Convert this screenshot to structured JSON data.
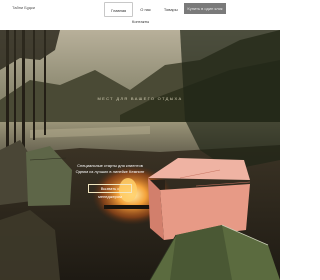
{
  "header": {
    "logo": "Тайни Будки",
    "nav": [
      {
        "label": "Главная",
        "active": true
      },
      {
        "label": "О нас",
        "active": false
      },
      {
        "label": "Товары",
        "active": false
      }
    ],
    "contacts": "Контакты",
    "cta_label": "Купить в один клик"
  },
  "hero": {
    "tagline": "МЕСТ ДЛЯ ВАШЕГО ОТДЫХА",
    "lines": [
      "Специальные старты для клиентов",
      "Одним из лучших в линейке Кемпинг"
    ],
    "button_label": "Вызвать с менеджером"
  },
  "colors": {
    "cta_bg": "#7a7a7a",
    "product_box": "#e79a86",
    "tent": "#5b6b3f"
  }
}
